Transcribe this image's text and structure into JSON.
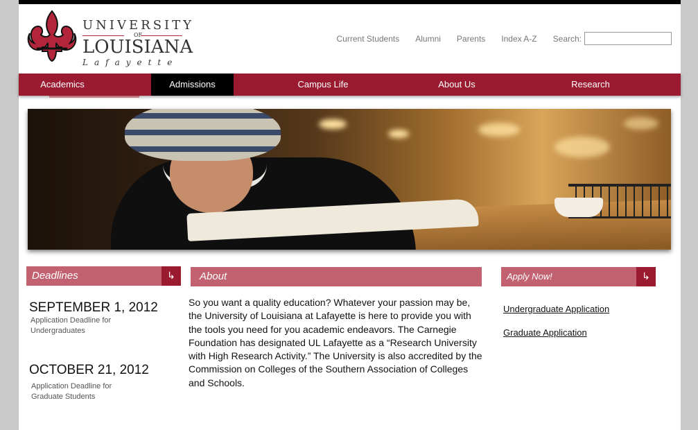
{
  "logo": {
    "university": "UNIVERSITY",
    "of": "OF",
    "louisiana": "LOUISIANA",
    "lafayette": "Lafayette",
    "brand_color": "#9a1a30"
  },
  "utility_nav": {
    "links": [
      "Current Students",
      "Alumni",
      "Parents",
      "Index A-Z"
    ],
    "search_label": "Search:",
    "search_value": ""
  },
  "main_nav": {
    "items": [
      {
        "label": "Academics",
        "active": false
      },
      {
        "label": "Admissions",
        "active": true
      },
      {
        "label": "Campus Life",
        "active": false
      },
      {
        "label": "About Us",
        "active": false
      },
      {
        "label": "Research",
        "active": false
      }
    ]
  },
  "deadlines": {
    "title": "Deadlines",
    "icon": "arrow-icon",
    "entries": [
      {
        "date": "SEPTEMBER 1, 2012",
        "desc_line1": "Application Deadline for",
        "desc_line2": "Undergraduates"
      },
      {
        "date": "OCTOBER 21, 2012",
        "desc_line1": "Application Deadline for",
        "desc_line2": "Graduate Students"
      }
    ]
  },
  "about": {
    "title": "About",
    "text": "So you want a quality education? Whatever your passion may be, the University of Louisiana at Lafayette is here to provide you with the tools you need for you academic endeavors. The Carnegie Foundation has designated UL Lafayette as a “Research University with High Research Activity.” The University is also accredited by the Commission on Colleges of the Southern Association of Colleges and Schools."
  },
  "apply": {
    "title": "Apply Now!",
    "icon": "arrow-icon",
    "links": [
      "Undergraduate Application",
      "Graduate Application"
    ]
  }
}
